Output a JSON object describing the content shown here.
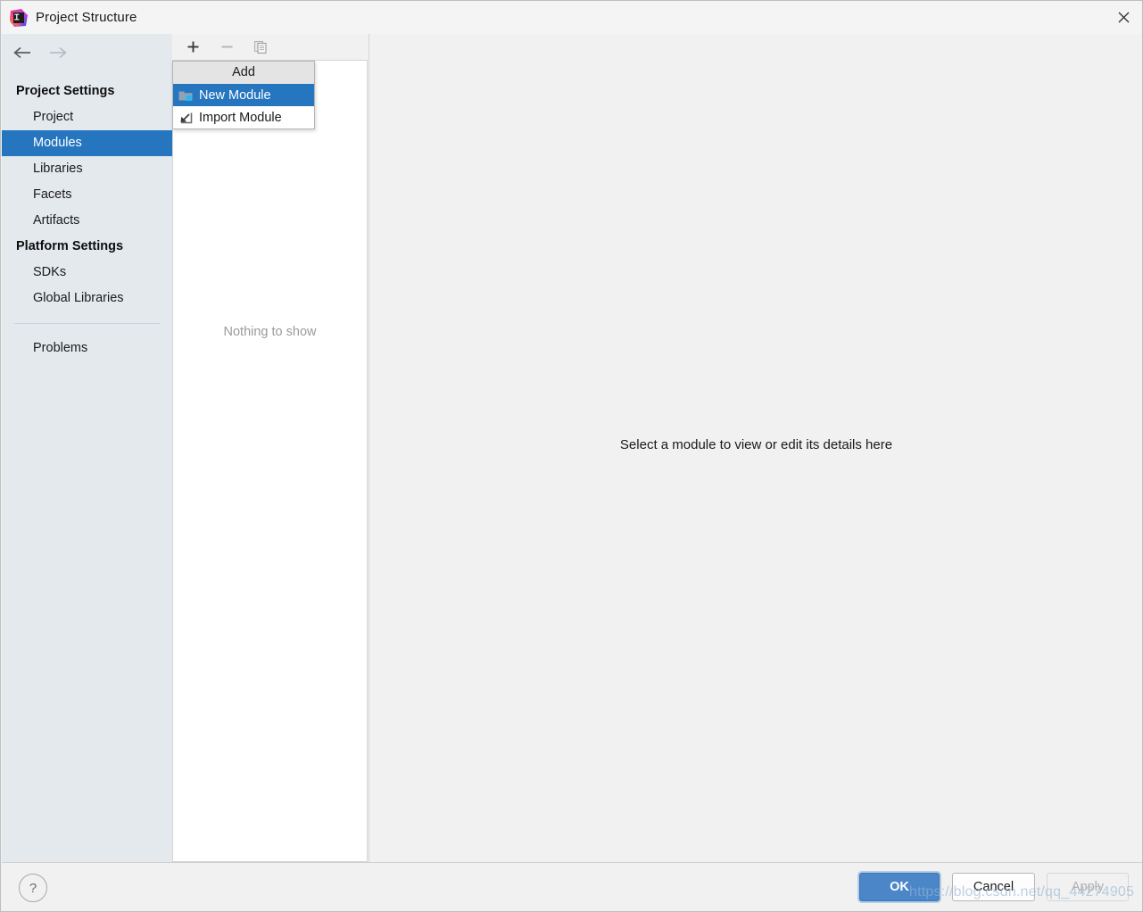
{
  "window": {
    "title": "Project Structure",
    "app_icon": "intellij-idea-logo",
    "close_label": "✕"
  },
  "sidebar": {
    "back_icon": "arrow-left-icon",
    "forward_icon": "arrow-right-icon",
    "groups": [
      {
        "title": "Project Settings",
        "items": [
          {
            "label": "Project",
            "selected": false
          },
          {
            "label": "Modules",
            "selected": true
          },
          {
            "label": "Libraries",
            "selected": false
          },
          {
            "label": "Facets",
            "selected": false
          },
          {
            "label": "Artifacts",
            "selected": false
          }
        ]
      },
      {
        "title": "Platform Settings",
        "items": [
          {
            "label": "SDKs",
            "selected": false
          },
          {
            "label": "Global Libraries",
            "selected": false
          }
        ]
      }
    ],
    "problems_label": "Problems"
  },
  "list_panel": {
    "toolbar": {
      "add_icon": "plus-icon",
      "remove_icon": "minus-icon",
      "copy_icon": "copy-icon"
    },
    "empty_message": "Nothing to show"
  },
  "add_menu": {
    "header": "Add",
    "items": [
      {
        "label": "New Module",
        "icon": "new-module-folder-icon",
        "highlighted": true
      },
      {
        "label": "Import Module",
        "icon": "import-module-arrow-icon",
        "highlighted": false
      }
    ]
  },
  "detail": {
    "message": "Select a module to view or edit its details here"
  },
  "footer": {
    "help_label": "?",
    "ok_label": "OK",
    "cancel_label": "Cancel",
    "apply_label": "Apply"
  },
  "watermark": {
    "text": "https://blog.csdn.net/qq_44274905"
  },
  "colors": {
    "accent_blue": "#2675bf",
    "ok_button": "#4a86c8",
    "sidebar_bg": "#e4e9ee",
    "panel_bg": "#f1f1f1"
  }
}
